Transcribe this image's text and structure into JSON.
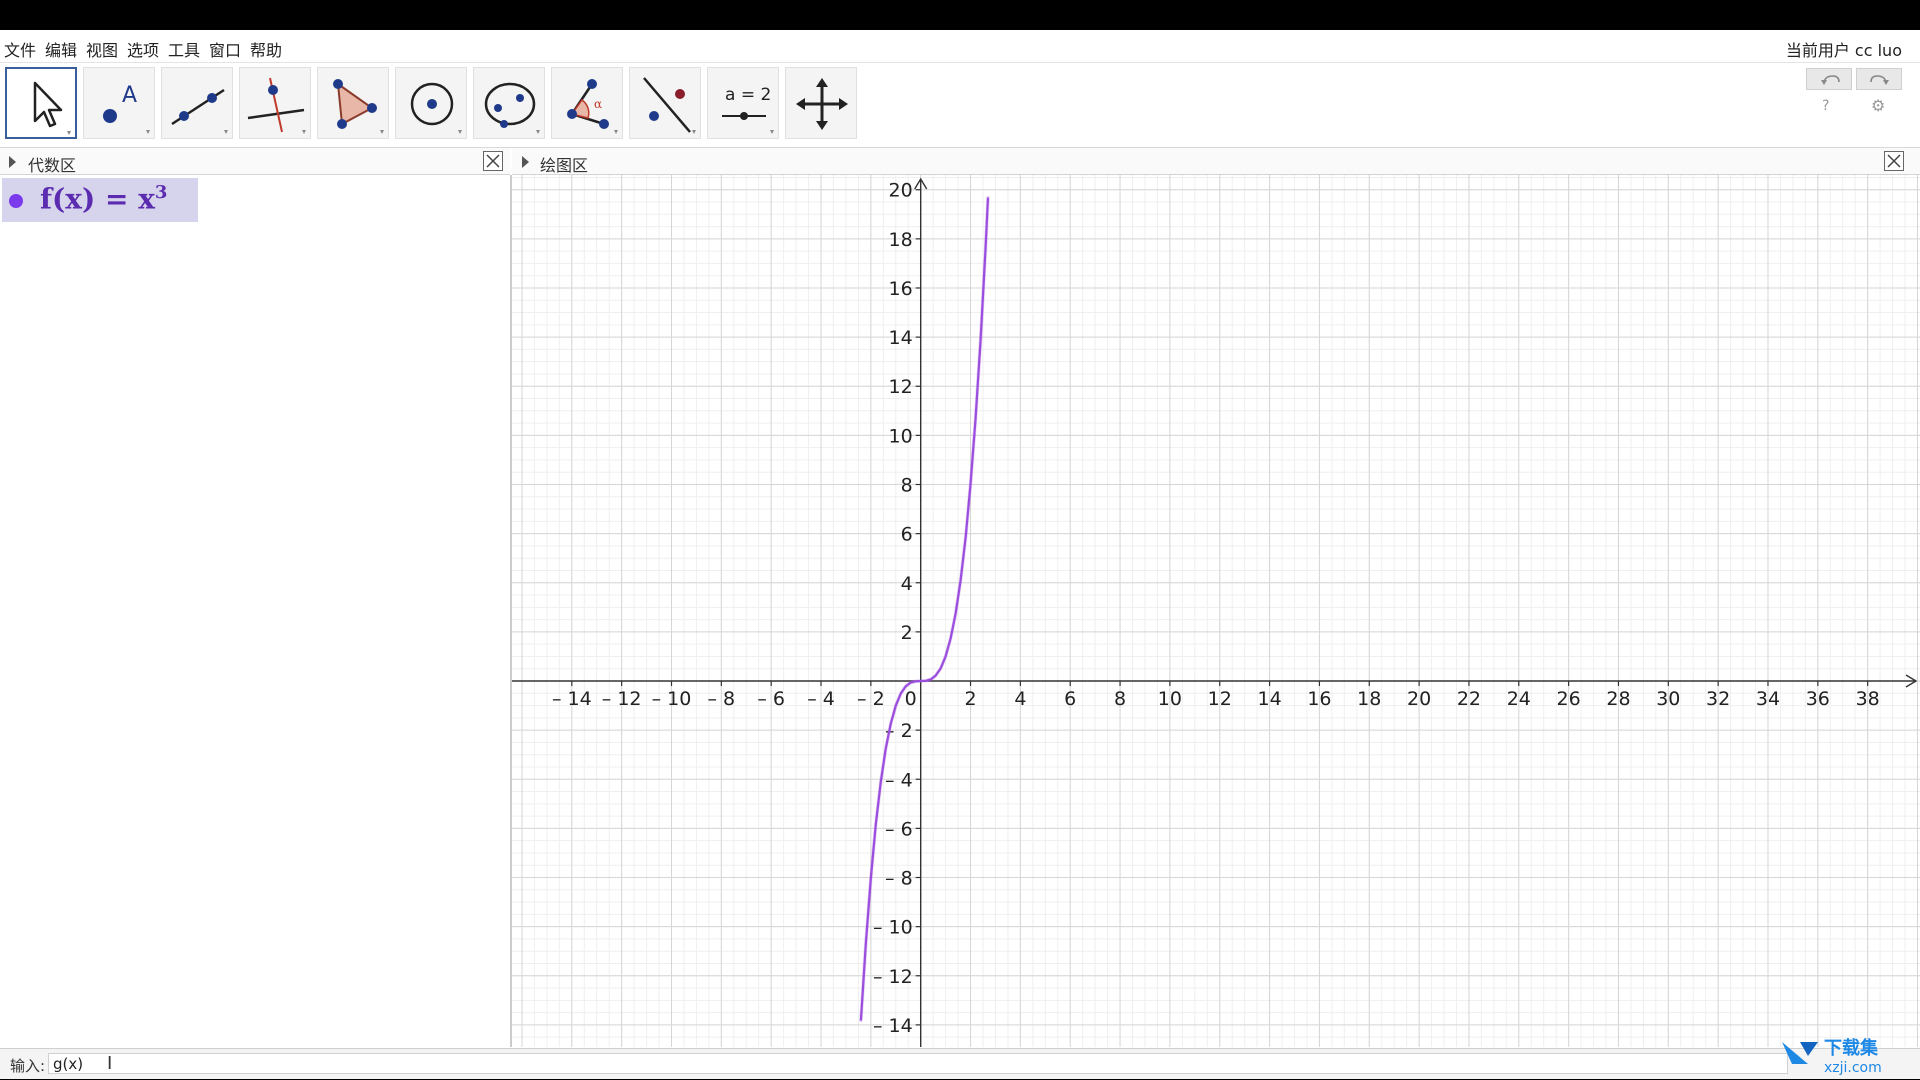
{
  "menu": [
    "文件",
    "编辑",
    "视图",
    "选项",
    "工具",
    "窗口",
    "帮助"
  ],
  "user_label": "当前用户 cc luo",
  "tools": [
    {
      "icon": "move-pointer-icon",
      "active": true
    },
    {
      "icon": "point-icon",
      "active": false
    },
    {
      "icon": "line-icon",
      "active": false
    },
    {
      "icon": "perpendicular-line-icon",
      "active": false
    },
    {
      "icon": "polygon-icon",
      "active": false
    },
    {
      "icon": "circle-center-point-icon",
      "active": false
    },
    {
      "icon": "ellipse-icon",
      "active": false
    },
    {
      "icon": "angle-icon",
      "active": false
    },
    {
      "icon": "reflect-icon",
      "active": false
    },
    {
      "icon": "slider-icon",
      "active": false
    },
    {
      "icon": "move-graphics-icon",
      "active": false
    }
  ],
  "slider_tool_text": "a = 2",
  "angle_symbol": "α",
  "algebra": {
    "title": "代数区",
    "expression": {
      "lhs": "f(x)",
      "eq": "=",
      "base": "x",
      "exp": "3"
    }
  },
  "graphics": {
    "title": "绘图区"
  },
  "input": {
    "label": "输入:",
    "value": "g(x)"
  },
  "watermark": {
    "top": "下载集",
    "bottom": "xzji.com"
  },
  "chart_data": {
    "type": "line",
    "function": "f(x) = x^3",
    "series": [
      {
        "name": "f",
        "color": "#9b4dde",
        "x": [
          -2.4,
          -2.2,
          -2,
          -1.8,
          -1.6,
          -1.4,
          -1.2,
          -1,
          -0.8,
          -0.6,
          -0.4,
          -0.2,
          0,
          0.2,
          0.4,
          0.6,
          0.8,
          1,
          1.2,
          1.4,
          1.6,
          1.8,
          2,
          2.2,
          2.4,
          2.6,
          2.7
        ],
        "y": [
          -13.82,
          -10.65,
          -8,
          -5.83,
          -4.1,
          -2.74,
          -1.73,
          -1,
          -0.51,
          -0.22,
          -0.06,
          -0.01,
          0,
          0.01,
          0.06,
          0.22,
          0.51,
          1,
          1.73,
          2.74,
          4.1,
          5.83,
          8,
          10.65,
          13.82,
          17.58,
          19.68
        ]
      }
    ],
    "x_ticks": [
      -14,
      -12,
      -10,
      -8,
      -6,
      -4,
      -2,
      0,
      2,
      4,
      6,
      8,
      10,
      12,
      14,
      16,
      18,
      20,
      22,
      24,
      26,
      28,
      30,
      32,
      34,
      36,
      38
    ],
    "y_ticks": [
      -14,
      -12,
      -10,
      -8,
      -6,
      -4,
      -2,
      2,
      4,
      6,
      8,
      10,
      12,
      14,
      16,
      18,
      20
    ],
    "xlim": [
      -16.4,
      40.1
    ],
    "ylim": [
      -14.9,
      20.6
    ],
    "grid": true
  }
}
